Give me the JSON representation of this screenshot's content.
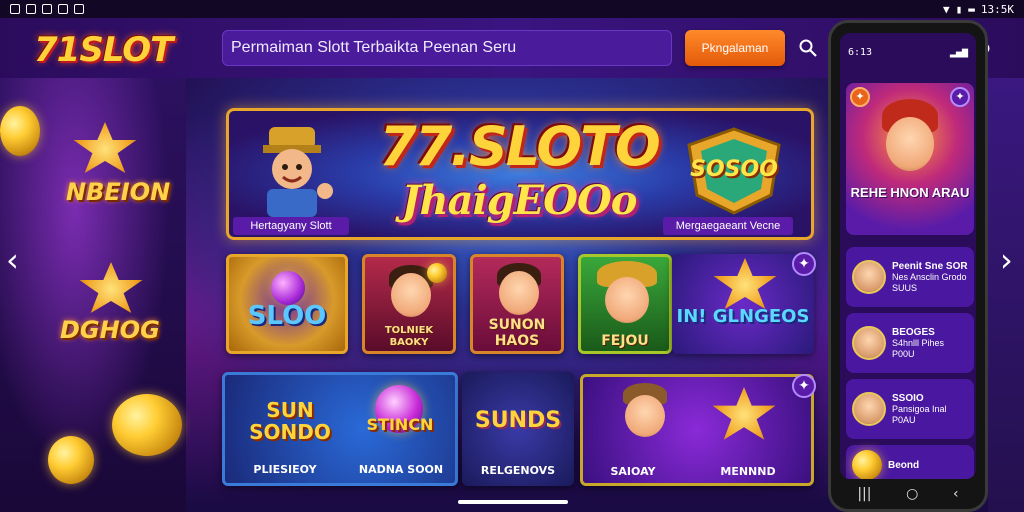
{
  "status_bar": {
    "right_text": "13:5K"
  },
  "header": {
    "logo": "71SLOT",
    "search_text": "Permaiman Slott Terbaikta Peenan Seru",
    "login_label": "Pkngalaman"
  },
  "left_panel": {
    "title_top": "NBEION",
    "title_bottom": "DGHOG"
  },
  "hero": {
    "title_line1": "77.SLOTO",
    "title_line2": "JhaigEOOo",
    "tag_left": "Hertagyany Slott",
    "tag_right": "Mergaegaeant Vecne",
    "badge_text": "SOSOO"
  },
  "games_row1": [
    {
      "label": "SLOO"
    },
    {
      "label": "TOLNIEK BAOKY"
    },
    {
      "label": "SUNON HAOS"
    },
    {
      "label": "FEJOU"
    },
    {
      "label": "IN! GLNGEOS"
    }
  ],
  "games_row2": [
    {
      "label_big": "SUN SONDO",
      "label_mid": "STINCN",
      "caption_left": "PLIESIEOY",
      "caption_right": "NADNA SOON"
    },
    {
      "label_big": "SUNDS",
      "caption": "RELGENOVS"
    },
    {
      "caption_left": "SAIOAY",
      "caption_right": "MENNND"
    }
  ],
  "phone": {
    "time": "6:13",
    "hero_title": "REHE HNON ARAU",
    "cards": [
      {
        "title": "Peenit Sne SOR",
        "line2": "Nes Ansclin Grodo",
        "line3": "SUUS"
      },
      {
        "title": "BEOGES",
        "line2": "S4hnlll Pihes",
        "line3": "P00U"
      },
      {
        "title": "SSOIO",
        "line2": "Pansigoa Inal",
        "line3": "P0AU"
      },
      {
        "title": "Beond",
        "line2": "",
        "line3": ""
      }
    ]
  },
  "colors": {
    "accent_orange": "#ff8a2a",
    "gold": "#ffd43a",
    "purple": "#3a1480"
  }
}
